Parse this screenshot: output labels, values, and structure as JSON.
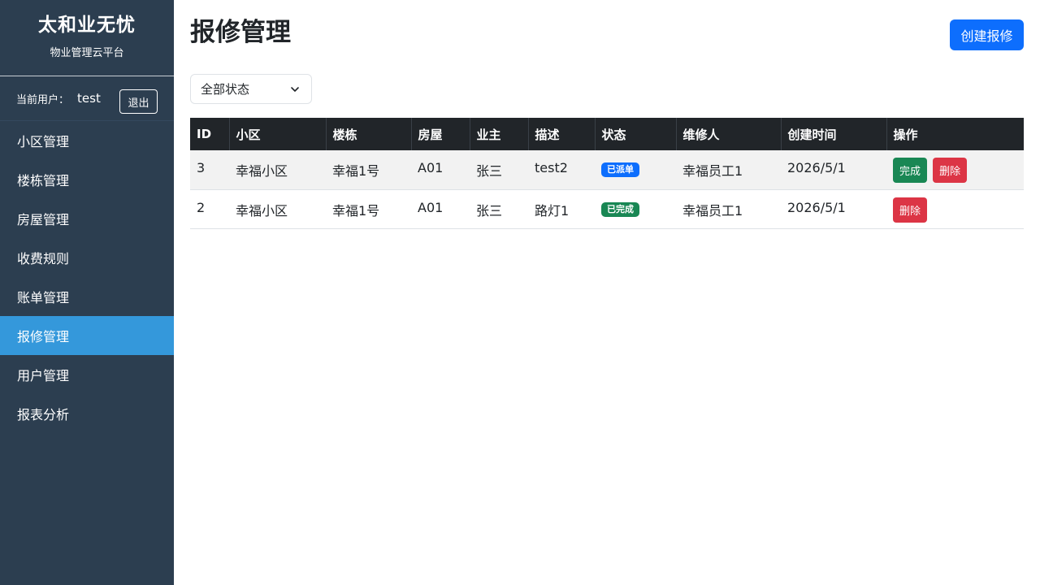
{
  "sidebar": {
    "brand_title": "太和业无忧",
    "brand_subtitle": "物业管理云平台",
    "user_label": "当前用户：",
    "user_name": "test",
    "logout_label": "退出",
    "items": [
      {
        "label": "小区管理"
      },
      {
        "label": "楼栋管理"
      },
      {
        "label": "房屋管理"
      },
      {
        "label": "收费规则"
      },
      {
        "label": "账单管理"
      },
      {
        "label": "报修管理",
        "active": true
      },
      {
        "label": "用户管理"
      },
      {
        "label": "报表分析"
      }
    ]
  },
  "header": {
    "title": "报修管理",
    "create_label": "创建报修"
  },
  "filter": {
    "selected": "全部状态"
  },
  "table": {
    "headers": [
      "ID",
      "小区",
      "楼栋",
      "房屋",
      "业主",
      "描述",
      "状态",
      "维修人",
      "创建时间",
      "操作"
    ],
    "rows": [
      {
        "id": "3",
        "community": "幸福小区",
        "building": "幸福1号",
        "house": "A01",
        "owner": "张三",
        "desc": "test2",
        "status": "已派单",
        "worker": "幸福员工1",
        "created": "2026/5/1",
        "complete_label": "完成",
        "delete_label": "删除"
      },
      {
        "id": "2",
        "community": "幸福小区",
        "building": "幸福1号",
        "house": "A01",
        "owner": "张三",
        "desc": "路灯1",
        "status": "已完成",
        "worker": "幸福员工1",
        "created": "2026/5/1",
        "delete_label": "删除"
      }
    ]
  },
  "colors": {
    "sidebar_bg": "#2c3e50",
    "active_item": "#3498db",
    "primary": "#0d6efd",
    "success": "#198754",
    "danger": "#dc3545",
    "table_header": "#212529"
  }
}
